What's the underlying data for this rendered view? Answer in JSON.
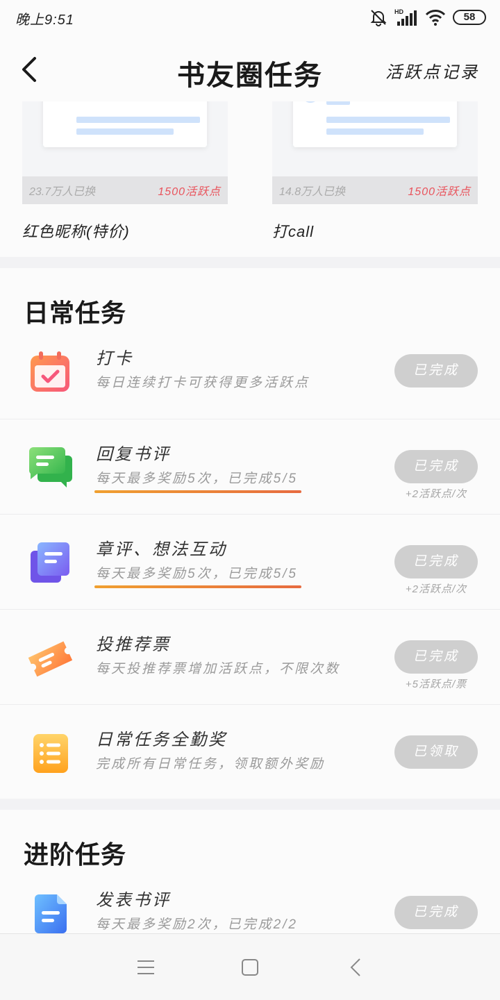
{
  "status_bar": {
    "time": "晚上9:51",
    "battery": "58",
    "network": "HD"
  },
  "header": {
    "title": "书友圈任务",
    "record_link": "活跃点记录"
  },
  "shop": {
    "items": [
      {
        "count": "23.7万人已换",
        "price": "1500活跃点",
        "name": "红色昵称(特价)"
      },
      {
        "count": "14.8万人已换",
        "price": "1500活跃点",
        "name": "打call"
      }
    ]
  },
  "daily": {
    "title": "日常任务",
    "tasks": [
      {
        "icon": "calendar-check-icon",
        "name": "打卡",
        "desc": "每日连续打卡可获得更多活跃点",
        "button": "已完成",
        "reward": ""
      },
      {
        "icon": "chat-bubble-icon",
        "name": "回复书评",
        "desc": "每天最多奖励5次，已完成5/5",
        "button": "已完成",
        "reward": "+2活跃点/次"
      },
      {
        "icon": "document-stack-icon",
        "name": "章评、想法互动",
        "desc": "每天最多奖励5次，已完成5/5",
        "button": "已完成",
        "reward": "+2活跃点/次"
      },
      {
        "icon": "ticket-icon",
        "name": "投推荐票",
        "desc": "每天投推荐票增加活跃点，不限次数",
        "button": "已完成",
        "reward": "+5活跃点/票"
      },
      {
        "icon": "list-note-icon",
        "name": "日常任务全勤奖",
        "desc": "完成所有日常任务，领取额外奖励",
        "button": "已领取",
        "reward": ""
      }
    ]
  },
  "advanced": {
    "title": "进阶任务",
    "tasks": [
      {
        "icon": "file-icon",
        "name": "发表书评",
        "desc": "每天最多奖励2次，已完成2/2",
        "button": "已完成",
        "reward": ""
      }
    ]
  },
  "colors": {
    "accent_red": "#e9535c",
    "underline_start": "#f0a030",
    "underline_end": "#e76b40",
    "button_gray": "#cfcfcf"
  }
}
